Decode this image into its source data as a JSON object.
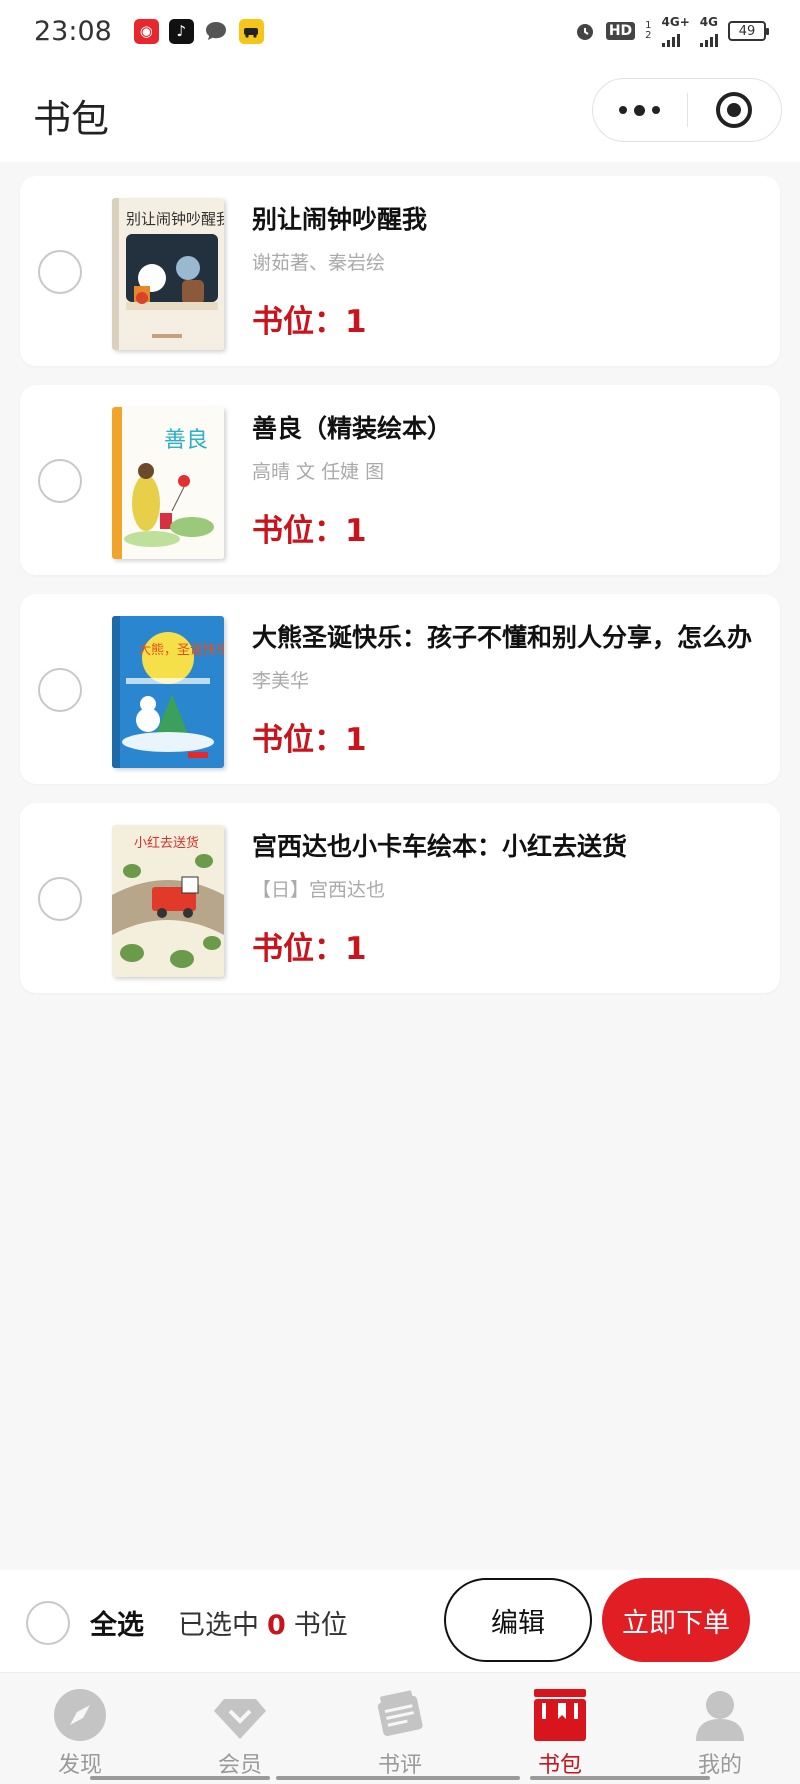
{
  "status_bar": {
    "time": "23:08",
    "network_1": "4G+",
    "network_2": "4G",
    "hd_label": "HD",
    "sim_label_1": "1",
    "sim_label_2": "2",
    "battery": "49",
    "icons": [
      "netease-music-icon",
      "tiktok-icon",
      "chat-icon",
      "taxi-icon",
      "alarm-icon"
    ]
  },
  "header": {
    "title": "书包",
    "more_icon": "more-dots-icon",
    "close_icon": "target-icon"
  },
  "books": [
    {
      "title": "别让闹钟吵醒我",
      "author": "谢茹著、秦岩绘",
      "slot_label": "书位：1",
      "cover_text": "别让闹钟吵醒我"
    },
    {
      "title": "善良（精装绘本）",
      "author": "高晴 文 任婕 图",
      "slot_label": "书位：1",
      "cover_text": "善良"
    },
    {
      "title": "大熊圣诞快乐：孩子不懂和别人分享，怎么办",
      "author": "李美华",
      "slot_label": "书位：1",
      "cover_text": "大熊，圣诞快乐"
    },
    {
      "title": "宫西达也小卡车绘本：小红去送货",
      "author": "【日】宫西达也",
      "slot_label": "书位：1",
      "cover_text": "小红去送货"
    }
  ],
  "action_bar": {
    "select_all": "全选",
    "selected_prefix": "已选中",
    "selected_count": "0",
    "selected_suffix": "书位",
    "edit_label": "编辑",
    "order_label": "立即下单"
  },
  "tabs": [
    {
      "label": "发现",
      "icon": "compass-icon",
      "active": false
    },
    {
      "label": "会员",
      "icon": "diamond-icon",
      "active": false
    },
    {
      "label": "书评",
      "icon": "review-icon",
      "active": false
    },
    {
      "label": "书包",
      "icon": "bookbag-icon",
      "active": true
    },
    {
      "label": "我的",
      "icon": "user-icon",
      "active": false
    }
  ],
  "colors": {
    "accent": "#c8141c",
    "order_button": "#e01e24",
    "background": "#f7f7f7"
  }
}
